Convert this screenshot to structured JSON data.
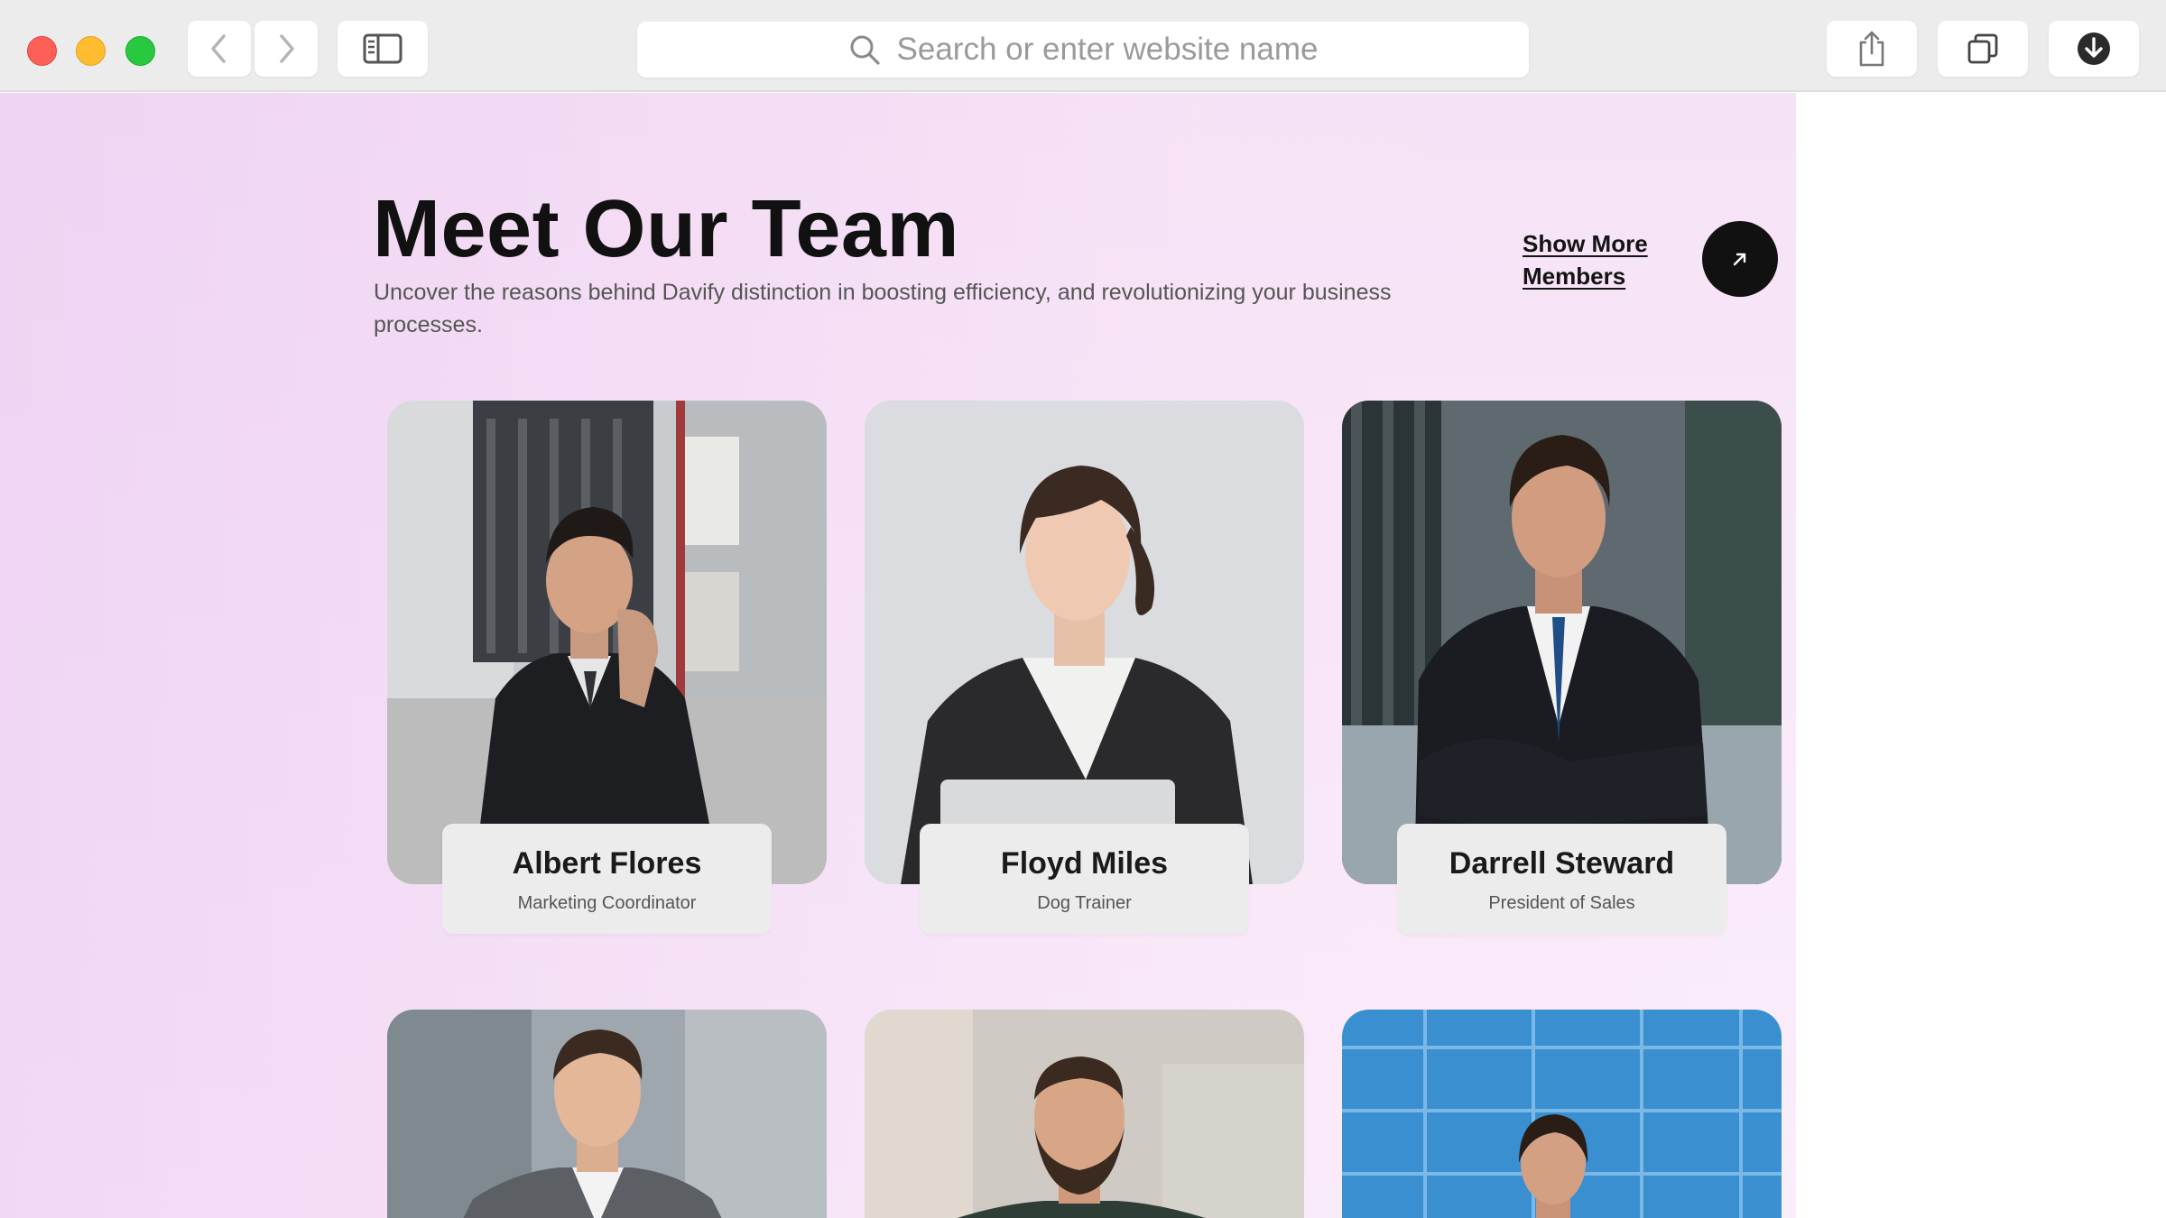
{
  "browser": {
    "search_placeholder": "Search or enter website name",
    "icons": [
      "back-icon",
      "forward-icon",
      "sidebar-icon",
      "search-icon",
      "share-icon",
      "tabs-icon",
      "download-icon"
    ]
  },
  "header": {
    "title": "Meet Our Team",
    "subtitle": "Uncover the reasons behind Davify distinction in boosting efficiency, and revolutionizing your business processes.",
    "show_more_label": "Show More Members",
    "arrow_icon": "arrow-up-right-icon"
  },
  "team": [
    {
      "name": "Albert Flores",
      "role": "Marketing Coordinator"
    },
    {
      "name": "Floyd Miles",
      "role": "Dog Trainer"
    },
    {
      "name": "Darrell Steward",
      "role": "President of Sales"
    }
  ],
  "colors": {
    "title": "#111111",
    "button_dark": "#111111",
    "card_label_bg": "#ececec",
    "page_bg": "#f6e2f6"
  }
}
